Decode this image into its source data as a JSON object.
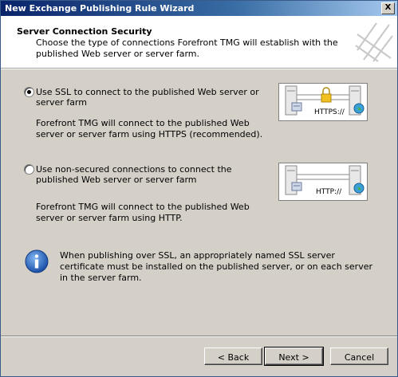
{
  "window": {
    "title": "New Exchange Publishing Rule Wizard",
    "close_glyph": "X"
  },
  "header": {
    "title": "Server Connection Security",
    "subtitle": "Choose the type of connections Forefront TMG will establish with the published Web server or server farm."
  },
  "options": [
    {
      "label": "Use SSL to connect to the published Web server or server farm",
      "description": "Forefront TMG will connect to the published Web server or server farm using HTTPS (recommended).",
      "selected": true,
      "diagram_text": "HTTPS://"
    },
    {
      "label": "Use non-secured connections to connect the published Web server or server farm",
      "description": "Forefront TMG will connect to the published Web server or server farm using HTTP.",
      "selected": false,
      "diagram_text": "HTTP://"
    }
  ],
  "info": {
    "text": "When publishing over SSL, an appropriately named SSL server certificate must be installed on the published server, or on each server in the server farm."
  },
  "buttons": {
    "back": "< Back",
    "next": "Next >",
    "cancel": "Cancel"
  },
  "colors": {
    "titlebar": "#0a246a",
    "face": "#d4d0c8",
    "info_blue": "#1a5bbd"
  },
  "icons": [
    "close-icon",
    "wizard-logo-icon",
    "server-icon",
    "lock-icon",
    "globe-icon",
    "info-icon"
  ]
}
